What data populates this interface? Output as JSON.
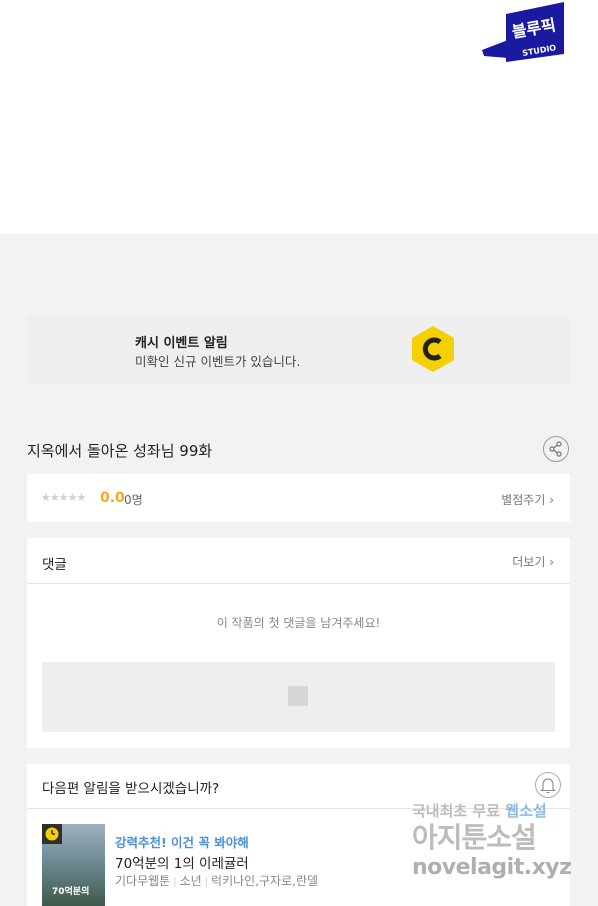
{
  "brand": {
    "logo_text": "블루픽",
    "logo_sub": "STUDIO",
    "color": "#1a1aa0"
  },
  "event_banner": {
    "title": "캐시 이벤트 알림",
    "subtitle": "미확인 신규 이벤트가 있습니다.",
    "icon": "coin-c-icon",
    "icon_color": "#f5d000"
  },
  "episode": {
    "title": "지옥에서 돌아온 성좌님 99화"
  },
  "rating": {
    "stars": "★★★★★",
    "score": "0.0",
    "count": "0명",
    "rate_button": "별점주기 ›"
  },
  "comments": {
    "header": "댓글",
    "more": "더보기 ›",
    "empty_message": "이 작품의 첫 댓글을 남겨주세요!"
  },
  "notify": {
    "question": "다음편 알림을 받으시겠습니까?",
    "recommend_label": "강력추천! 이건 꼭 봐야해",
    "rec_title": "70억분의 1의 이레귤러",
    "rec_genre": "기다무웹툰",
    "rec_category": "소년",
    "rec_authors": "럭키나인,구자로,란델",
    "thumb_text": "70억분의"
  },
  "watermark": {
    "line1_a": "국내최초 무료",
    "line1_b": "웹소설",
    "line2": "아지툰소설",
    "line3": "novelagit.xyz"
  }
}
